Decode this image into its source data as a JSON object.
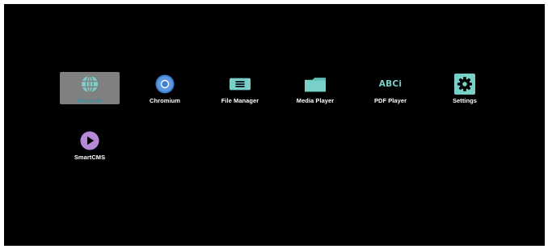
{
  "launcher": {
    "apps": [
      {
        "label": "Browser",
        "icon": "globe-icon",
        "selected": true
      },
      {
        "label": "Chromium",
        "icon": "chromium-icon",
        "selected": false
      },
      {
        "label": "File Manager",
        "icon": "file-manager-icon",
        "selected": false
      },
      {
        "label": "Media Player",
        "icon": "folder-icon",
        "selected": false
      },
      {
        "label": "PDF Player",
        "icon": "pdf-player-icon",
        "selected": false
      },
      {
        "label": "Settings",
        "icon": "gear-icon",
        "selected": false
      },
      {
        "label": "SmartCMS",
        "icon": "play-icon",
        "selected": false
      }
    ],
    "pdf_icon_text": "ABCi"
  },
  "colors": {
    "background": "#000000",
    "selection": "#808080",
    "teal": "#79d0c9",
    "chromium_blue": "#4a90d9",
    "smartcms_purple": "#b88ad6"
  }
}
